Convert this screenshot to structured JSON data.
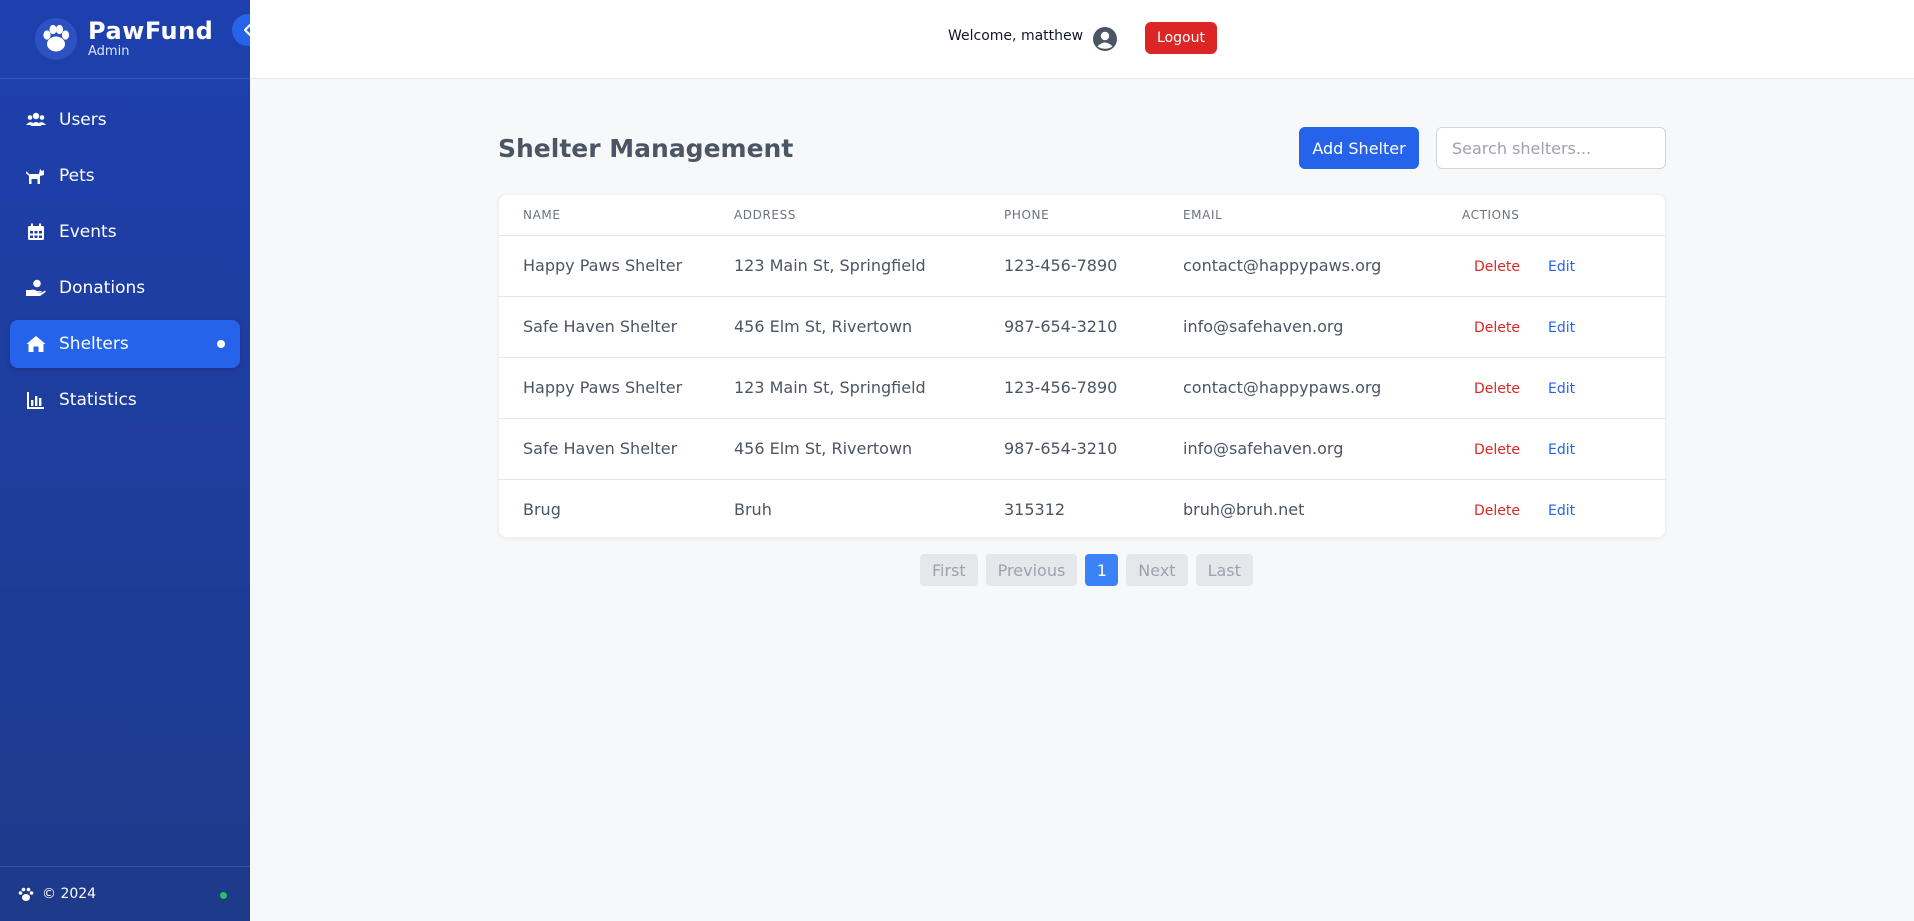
{
  "brand": {
    "name": "PawFund",
    "subtitle": "Admin"
  },
  "sidebar": {
    "items": [
      {
        "label": "Users",
        "icon": "users-icon"
      },
      {
        "label": "Pets",
        "icon": "pet-icon"
      },
      {
        "label": "Events",
        "icon": "calendar-icon"
      },
      {
        "label": "Donations",
        "icon": "donation-hand-icon"
      },
      {
        "label": "Shelters",
        "icon": "home-icon",
        "active": true
      },
      {
        "label": "Statistics",
        "icon": "bar-chart-icon"
      }
    ],
    "footer": "© 2024"
  },
  "header": {
    "welcome": "Welcome, matthew",
    "logout_label": "Logout"
  },
  "page": {
    "title": "Shelter Management",
    "add_label": "Add Shelter",
    "search_placeholder": "Search shelters..."
  },
  "table": {
    "columns": [
      "NAME",
      "ADDRESS",
      "PHONE",
      "EMAIL",
      "ACTIONS"
    ],
    "rows": [
      {
        "name": "Happy Paws Shelter",
        "address": "123 Main St, Springfield",
        "phone": "123-456-7890",
        "email": "contact@happypaws.org"
      },
      {
        "name": "Safe Haven Shelter",
        "address": "456 Elm St, Rivertown",
        "phone": "987-654-3210",
        "email": "info@safehaven.org"
      },
      {
        "name": "Happy Paws Shelter",
        "address": "123 Main St, Springfield",
        "phone": "123-456-7890",
        "email": "contact@happypaws.org"
      },
      {
        "name": "Safe Haven Shelter",
        "address": "456 Elm St, Rivertown",
        "phone": "987-654-3210",
        "email": "info@safehaven.org"
      },
      {
        "name": "Brug",
        "address": "Bruh",
        "phone": "315312",
        "email": "bruh@bruh.net"
      }
    ],
    "delete_label": "Delete",
    "edit_label": "Edit"
  },
  "pagination": {
    "first": "First",
    "previous": "Previous",
    "current": "1",
    "next": "Next",
    "last": "Last"
  },
  "colors": {
    "sidebar": "#1e40af",
    "accent": "#2563eb",
    "danger": "#dc2626",
    "status": "#22c55e"
  }
}
